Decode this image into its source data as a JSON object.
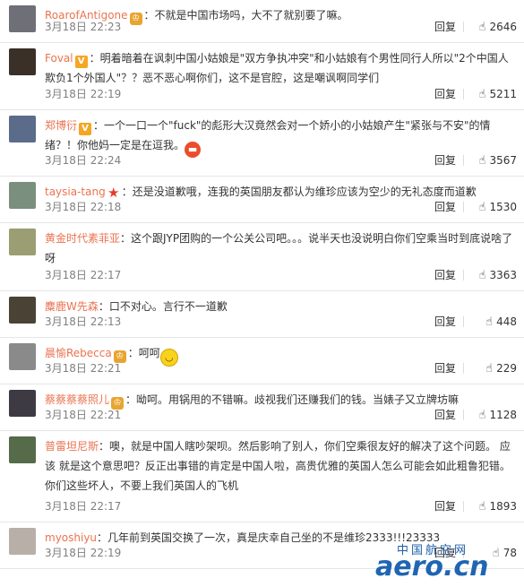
{
  "comments": [
    {
      "user": "RoarofAntigone",
      "badge": "vip",
      "text": "：不就是中国市场吗，大不了就别要了嘛。",
      "date": "3月18日 22:23",
      "reply": "回复",
      "likes": "2646",
      "avatar_color": "#6f6f78"
    },
    {
      "user": "Foval",
      "badge": "v",
      "text": "：明着暗着在讽刺中国小姑娘是\"双方争执冲突\"和小姑娘有个男性同行人所以\"2个中国人欺负1个外国人\"？？恶不恶心啊你们，这不是官腔，这是嘲讽啊同学们",
      "date": "3月18日 22:19",
      "reply": "回复",
      "likes": "5211",
      "avatar_color": "#3a3028"
    },
    {
      "user": "郑博衍",
      "badge": "v",
      "text": "：一个一口一个\"fuck\"的彪形大汉竟然会对一个娇小的小姑娘产生\"紧张与不安\"的情绪？！你他妈一定是在逗我。",
      "emoji": "angry",
      "date": "3月18日 22:24",
      "reply": "回复",
      "likes": "3567",
      "avatar_color": "#5b6c8a"
    },
    {
      "user": "taysia-tang",
      "badge": "star",
      "text": "：还是没道歉哦，连我的英国朋友都认为维珍应该为空少的无礼态度而道歉",
      "date": "3月18日 22:18",
      "reply": "回复",
      "likes": "1530",
      "avatar_color": "#7a8f7d"
    },
    {
      "user": "黄金时代素菲亚",
      "badge": "",
      "text": "：这个跟JYP团购的一个公关公司吧。。。说半天也没说明白你们空乘当时到底说啥了呀",
      "date": "3月18日 22:17",
      "reply": "回复",
      "likes": "3363",
      "avatar_color": "#9a9e72"
    },
    {
      "user": "麋鹿W先森",
      "badge": "",
      "text": "：口不对心。言行不一道歉",
      "date": "3月18日 22:13",
      "reply": "回复",
      "likes": "448",
      "avatar_color": "#4b4236"
    },
    {
      "user": "晨愉Rebecca",
      "badge": "vip",
      "text": "：呵呵",
      "emoji": "smile",
      "date": "3月18日 22:21",
      "reply": "回复",
      "likes": "229",
      "avatar_color": "#8a8a8a"
    },
    {
      "user": "蔡蔡蔡蔡照儿",
      "badge": "vip",
      "text": "：呦呵。用锅甩的不错嘛。歧视我们还赚我们的钱。当婊子又立牌坊嘛",
      "date": "3月18日 22:21",
      "reply": "回复",
      "likes": "1128",
      "avatar_color": "#3d3a44"
    },
    {
      "user": "普雷坦尼斯",
      "badge": "",
      "text": "：噢，就是中国人瞎吵架呗。然后影响了别人，你们空乘很友好的解决了这个问题。 应该 就是这个意思吧？反正出事错的肯定是中国人啦，高贵优雅的英国人怎么可能会如此粗鲁犯错。你们这些坏人，不要上我们英国人的飞机",
      "date": "3月18日 22:17",
      "reply": "回复",
      "likes": "1893",
      "avatar_color": "#556b4a"
    },
    {
      "user": "myoshiyu",
      "badge": "",
      "text": "：几年前到英国交换了一次，真是庆幸自己坐的不是维珍2333!!!23333",
      "date": "3月18日 22:19",
      "reply": "回复",
      "likes": "78",
      "avatar_color": "#b8b0a8"
    }
  ],
  "watermark": {
    "cn": "中国航空网",
    "en": "aero.cn"
  }
}
